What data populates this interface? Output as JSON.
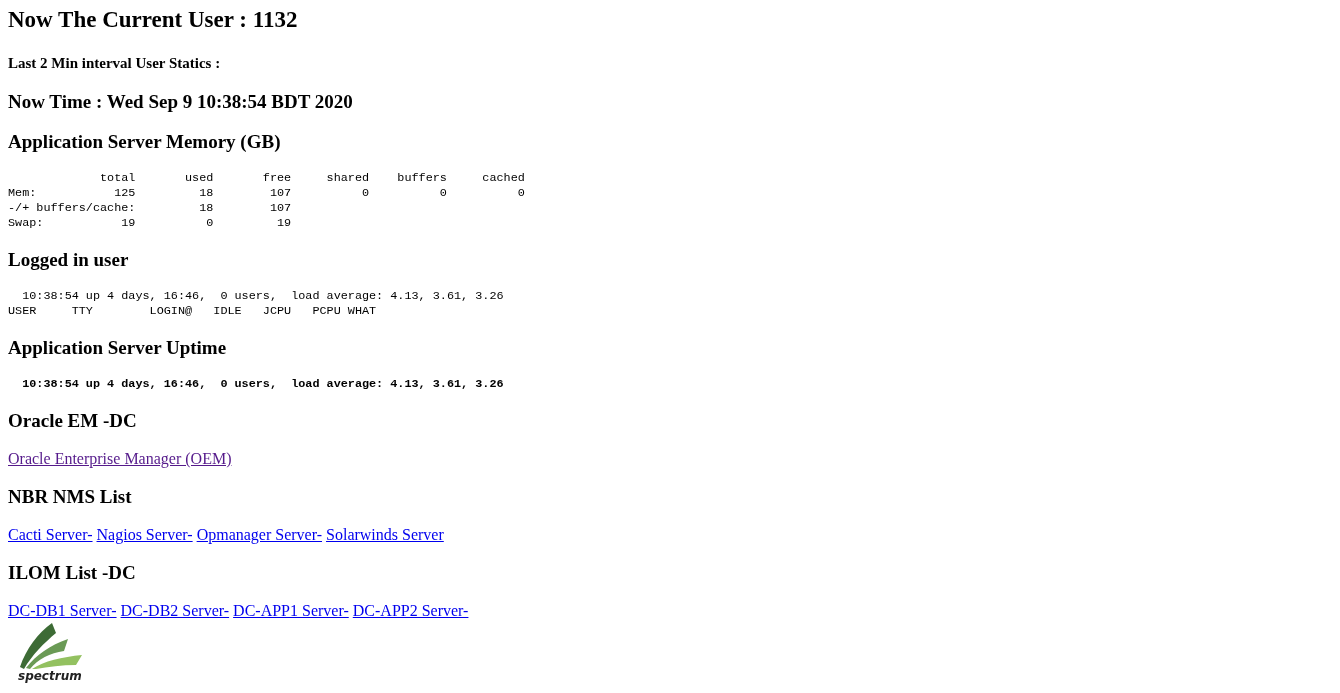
{
  "title": "Now The Current User : 1132",
  "subtitle": "Last 2 Min interval User Statics :",
  "now_time": "Now Time : Wed Sep 9 10:38:54 BDT 2020",
  "sections": [
    {
      "heading": "Application Server Memory (GB)",
      "kind": "pre",
      "lines": [
        "             total       used       free     shared    buffers     cached",
        "Mem:           125         18        107          0          0          0",
        "-/+ buffers/cache:         18        107",
        "Swap:           19          0         19"
      ]
    },
    {
      "heading": "Logged in user",
      "kind": "pre",
      "lines": [
        "  10:38:54 up 4 days, 16:46,  0 users,  load average: 4.13, 3.61, 3.26",
        "USER     TTY        LOGIN@   IDLE   JCPU   PCPU WHAT"
      ]
    },
    {
      "heading": "Application Server Uptime",
      "kind": "pre_bold",
      "lines": [
        "  10:38:54 up 4 days, 16:46,  0 users,  load average: 4.13, 3.61, 3.26"
      ]
    },
    {
      "heading": "Oracle EM -DC",
      "kind": "links",
      "links": [
        {
          "label": "Oracle Enterprise Manager (OEM)",
          "visited": true
        }
      ]
    },
    {
      "heading": "NBR NMS List",
      "kind": "links",
      "links": [
        {
          "label": "Cacti Server-",
          "visited": false
        },
        {
          "label": "Nagios Server-",
          "visited": false
        },
        {
          "label": "Opmanager Server-",
          "visited": false
        },
        {
          "label": "Solarwinds Server",
          "visited": false
        }
      ]
    },
    {
      "heading": "ILOM List -DC",
      "kind": "links",
      "links": [
        {
          "label": "DC-DB1 Server-",
          "visited": false
        },
        {
          "label": "DC-DB2 Server-",
          "visited": false
        },
        {
          "label": "DC-APP1 Server-",
          "visited": false
        },
        {
          "label": "DC-APP2 Server-",
          "visited": false
        }
      ]
    }
  ],
  "logo": {
    "wordmark": "spectrum"
  }
}
